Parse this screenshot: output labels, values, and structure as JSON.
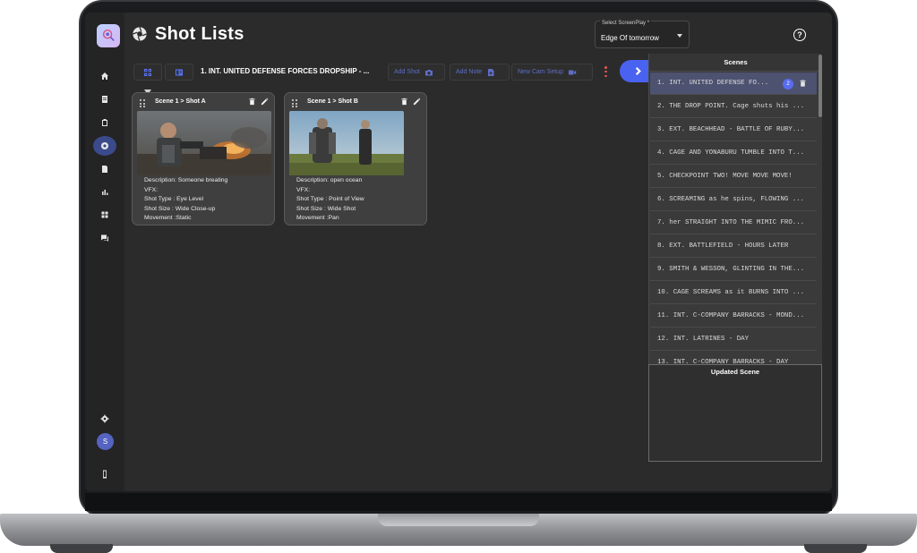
{
  "app": {
    "title": "Shot Lists"
  },
  "screenplay_select": {
    "label": "Select ScreenPlay *",
    "value": "Edge Of tomorrow"
  },
  "sidebar": {
    "items": [
      {
        "name": "home-icon"
      },
      {
        "name": "script-icon"
      },
      {
        "name": "clipboard-icon"
      },
      {
        "name": "shot-list-icon",
        "active": true
      },
      {
        "name": "document-icon"
      },
      {
        "name": "chart-icon"
      },
      {
        "name": "grid-icon"
      },
      {
        "name": "chat-icon"
      }
    ],
    "avatar_initial": "S"
  },
  "toolbar": {
    "scene_heading": "1. INT. UNITED DEFENSE FORCES DROPSHIP - ...",
    "add_shot": "Add Shot",
    "add_note": "Add Note",
    "new_cam_setup": "New Cam Setup"
  },
  "shots": [
    {
      "title": "Scene 1 > Shot A",
      "description": "Description: Someone breating",
      "vfx": "VFX:",
      "shot_type": "Shot Type : Eye Level",
      "shot_size": "Shot Size : Wide Close-up",
      "movement": "Movement :Static"
    },
    {
      "title": "Scene 1 > Shot B",
      "description": "Description: open ocean",
      "vfx": "VFX:",
      "shot_type": "Shot Type : Point of View",
      "shot_size": "Shot Size : Wide Shot",
      "movement": "Movement :Pan"
    }
  ],
  "scenes_panel": {
    "title": "Scenes",
    "selected_badge": "2",
    "items": [
      "1. INT. UNITED DEFENSE FO...",
      "2. THE DROP POINT. Cage shuts his ...",
      "3. EXT. BEACHHEAD - BATTLE OF RUBY...",
      "4. CAGE AND YONABURU TUMBLE INTO T...",
      "5. CHECKPOINT TWO! MOVE MOVE MOVE!",
      "6. SCREAMING as he spins, FLOWING ...",
      "7. her STRAIGHT INTO THE MIMIC FRO...",
      "8. EXT. BATTLEFIELD - HOURS LATER",
      "9. SMITH & WESSON, GLINTING IN THE...",
      "10. CAGE SCREAMS as it BURNS INTO ...",
      "11. INT. C-COMPANY BARRACKS - MOND...",
      "12. INT. LATRINES - DAY",
      "13. INT. C-COMPANY BARRACKS - DAY"
    ]
  },
  "updated_scene": {
    "title": "Updated Scene"
  }
}
